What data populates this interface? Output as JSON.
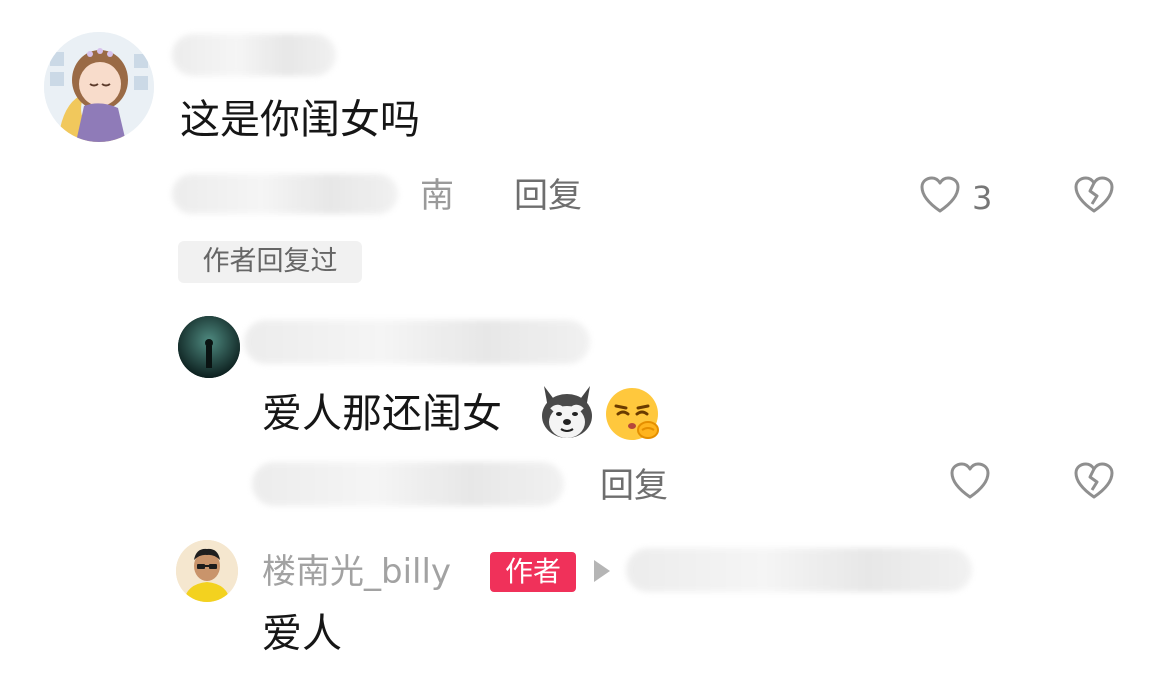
{
  "comment": {
    "text": "这是你闺女吗",
    "username_visible_tail": "南",
    "reply_label": "回复",
    "like_count": "3",
    "author_replied_tag": "作者回复过"
  },
  "reply1": {
    "text": "爱人那还闺女",
    "emojis": [
      "husky-dog-emoji",
      "shushing-face-emoji"
    ],
    "reply_label": "回复"
  },
  "reply2": {
    "username": "楼南光_billy",
    "author_badge": "作者",
    "text": "爱人"
  },
  "colors": {
    "author_badge": "#f0315a",
    "secondary_text": "#9a9a9a",
    "primary_text": "#161616"
  }
}
